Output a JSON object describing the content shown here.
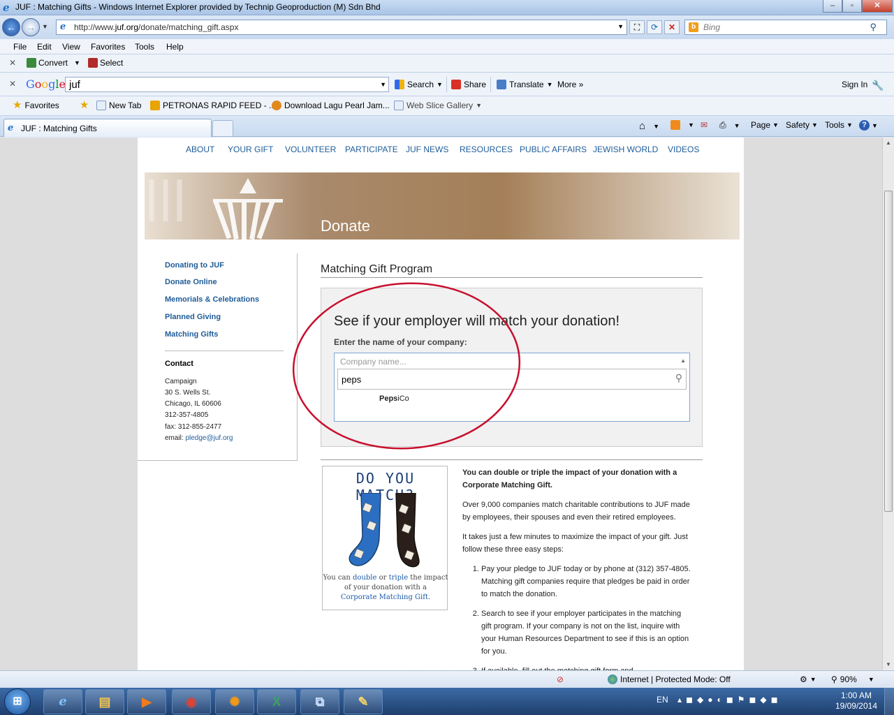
{
  "window": {
    "title": "JUF : Matching Gifts - Windows Internet Explorer provided by Technip Geoproduction (M) Sdn Bhd",
    "minimize_glyph": "–",
    "maximize_glyph": "▫",
    "close_glyph": "✕"
  },
  "address_bar": {
    "url_prefix": "http://www.",
    "url_domain": "juf.org",
    "url_path": "/donate/matching_gift.aspx",
    "search_placeholder": "Bing"
  },
  "menu": [
    "File",
    "Edit",
    "View",
    "Favorites",
    "Tools",
    "Help"
  ],
  "convert_bar": {
    "convert_label": "Convert",
    "select_label": "Select"
  },
  "google_bar": {
    "logo_letters": [
      "G",
      "o",
      "o",
      "g",
      "l",
      "e"
    ],
    "query": "juf",
    "search_label": "Search",
    "share_label": "Share",
    "translate_label": "Translate",
    "more_label": "More »",
    "sign_in_label": "Sign In"
  },
  "favorites_bar": {
    "favorites_label": "Favorites",
    "items": [
      "New Tab",
      "PETRONAS RAPID FEED - ...",
      "Download Lagu Pearl Jam...",
      "Web Slice Gallery"
    ]
  },
  "tab": {
    "title": "JUF : Matching Gifts"
  },
  "command_bar": {
    "page_label": "Page",
    "safety_label": "Safety",
    "tools_label": "Tools"
  },
  "site_nav": [
    "ABOUT",
    "YOUR GIFT",
    "VOLUNTEER",
    "PARTICIPATE",
    "JUF NEWS",
    "RESOURCES",
    "PUBLIC AFFAIRS",
    "JEWISH WORLD",
    "VIDEOS"
  ],
  "banner": {
    "title": "Donate"
  },
  "sidebar": {
    "links": [
      "Donating to JUF",
      "Donate Online",
      "Memorials & Celebrations",
      "Planned Giving",
      "Matching Gifts"
    ],
    "contact_heading": "Contact",
    "contact_lines": [
      "Campaign",
      "30 S. Wells St.",
      "Chicago, IL 60606",
      "312-357-4805",
      "fax: 312-855-2477"
    ],
    "email_label": "email: ",
    "email": "pledge@juf.org"
  },
  "main": {
    "title": "Matching Gift Program",
    "search_heading": "See if your employer will match your donation!",
    "search_label": "Enter the name of your company:",
    "company_placeholder": "Company name...",
    "company_query": "peps",
    "suggestion_match": "Peps",
    "suggestion_rest": "iCo",
    "promo": {
      "heading": "DO YOU MATCH?",
      "caption_1": "You can ",
      "caption_double": "double",
      "caption_2": " or ",
      "caption_triple": "triple",
      "caption_3": " the impact of your donation with a",
      "caption_cmg": "Corporate Matching Gift."
    },
    "intro_bold": "You can double or triple the impact of your donation with a Corporate Matching Gift.",
    "para_1": "Over 9,000 companies match charitable contributions to JUF made by employees, their spouses and even their retired employees.",
    "para_2": "It takes just a few minutes to maximize the impact of your gift.  Just follow these three easy steps:",
    "steps": [
      "Pay your pledge to JUF today or by phone at (312) 357-4805.  Matching gift companies require that pledges be paid in order to match the donation.",
      "Search to see if your employer participates in the matching gift program. If your company is not on the list, inquire with your Human Resources Department to see if this is an option for you.",
      "If available, fill out the matching gift form and...."
    ]
  },
  "status_bar": {
    "zone": "Internet | Protected Mode: Off",
    "zoom": "90%"
  },
  "taskbar": {
    "lang": "EN",
    "time": "1:00 AM",
    "date": "19/09/2014"
  },
  "colors": {
    "link": "#1f5c99",
    "annotation": "#c8102e",
    "banner": "#a47f58"
  }
}
